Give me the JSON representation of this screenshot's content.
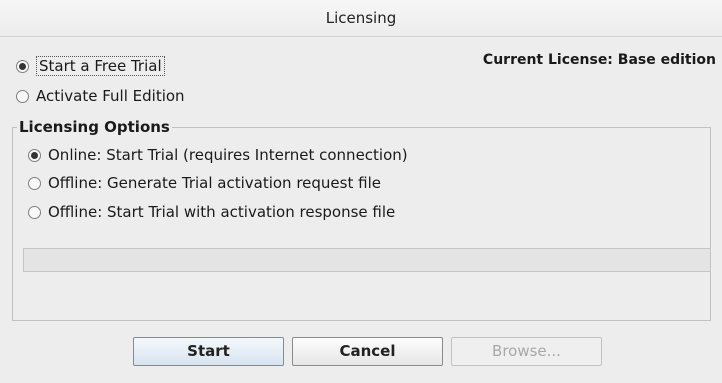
{
  "window": {
    "title": "Licensing"
  },
  "mode": {
    "options": [
      {
        "label": "Start a Free Trial",
        "selected": true
      },
      {
        "label": "Activate Full Edition",
        "selected": false
      }
    ]
  },
  "current_license": "Current License: Base edition",
  "licensing_options": {
    "legend": "Licensing Options",
    "options": [
      {
        "label": "Online: Start Trial (requires Internet connection)",
        "selected": true
      },
      {
        "label": "Offline: Generate Trial activation request file",
        "selected": false
      },
      {
        "label": "Offline: Start Trial with activation response file",
        "selected": false
      }
    ],
    "progress": 0
  },
  "buttons": {
    "start": "Start",
    "cancel": "Cancel",
    "browse": "Browse..."
  }
}
